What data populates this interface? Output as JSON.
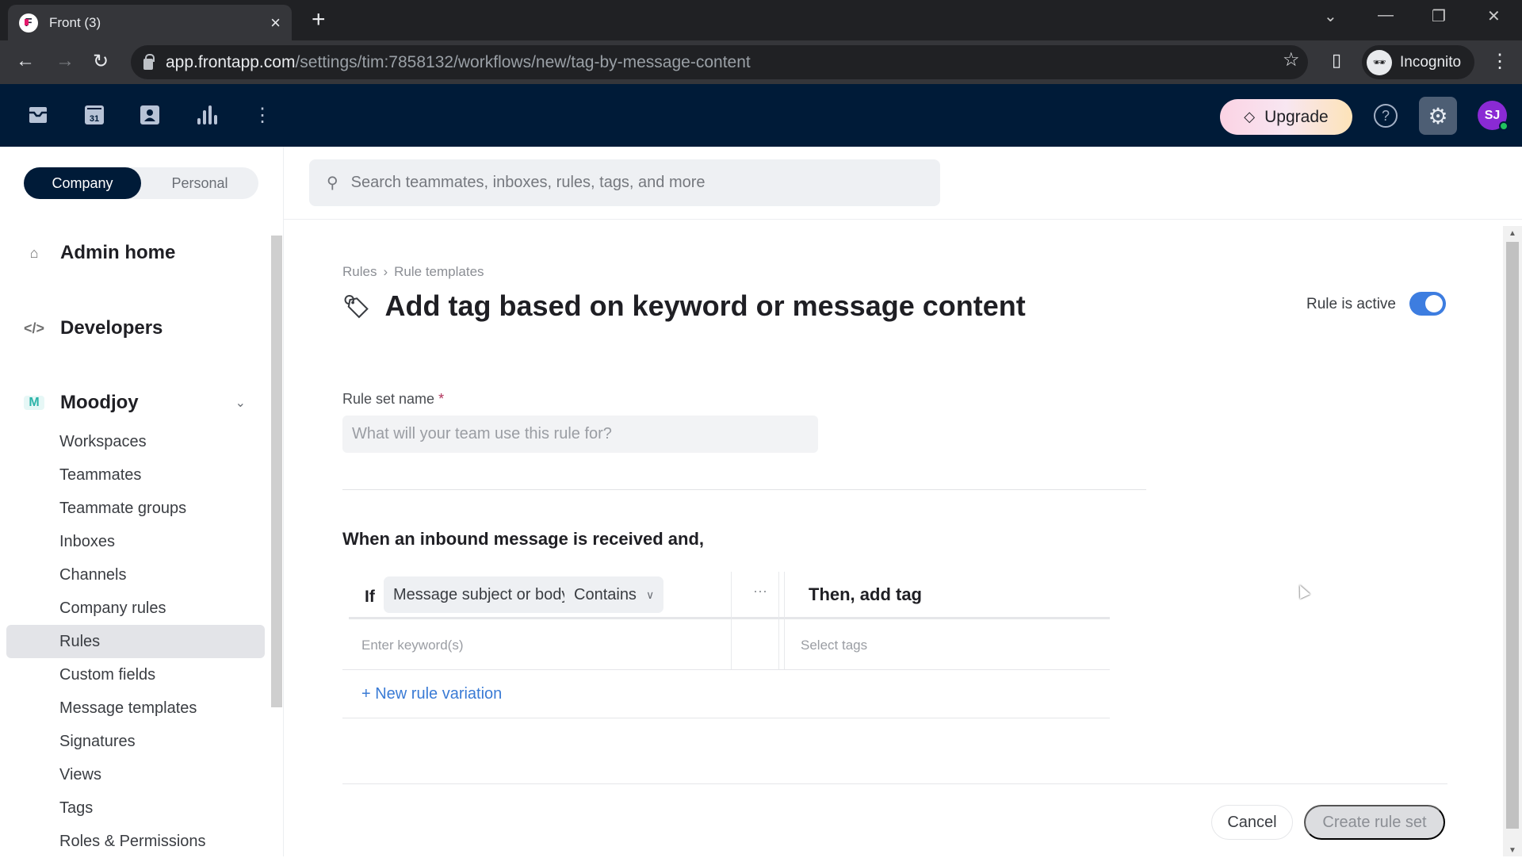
{
  "browser": {
    "tab_title": "Front (3)",
    "url_host": "app.frontapp.com",
    "url_path": "/settings/tim:7858132/workflows/new/tag-by-message-content",
    "profile_label": "Incognito"
  },
  "appbar": {
    "icons": [
      "inbox-icon",
      "calendar-icon",
      "contacts-icon",
      "analytics-icon",
      "more-icon"
    ],
    "calendar_day": "31",
    "upgrade_label": "Upgrade",
    "help_glyph": "?",
    "avatar_initials": "SJ",
    "colors": {
      "background": "#001b38",
      "avatar": "#8a2ad4",
      "presence": "#21c25e"
    }
  },
  "sidebar": {
    "segment": {
      "company": "Company",
      "personal": "Personal",
      "selected": "Company"
    },
    "top_items": [
      {
        "label": "Admin home",
        "icon": "home-icon"
      },
      {
        "label": "Developers",
        "icon": "code-icon"
      }
    ],
    "workspace": {
      "badge": "M",
      "label": "Moodjoy"
    },
    "items": [
      {
        "label": "Workspaces"
      },
      {
        "label": "Teammates"
      },
      {
        "label": "Teammate groups"
      },
      {
        "label": "Inboxes"
      },
      {
        "label": "Channels"
      },
      {
        "label": "Company rules"
      },
      {
        "label": "Rules",
        "active": true
      },
      {
        "label": "Custom fields"
      },
      {
        "label": "Message templates"
      },
      {
        "label": "Signatures"
      },
      {
        "label": "Views"
      },
      {
        "label": "Tags"
      },
      {
        "label": "Roles & Permissions"
      }
    ]
  },
  "search": {
    "placeholder": "Search teammates, inboxes, rules, tags, and more"
  },
  "page": {
    "breadcrumb": [
      "Rules",
      "Rule templates"
    ],
    "breadcrumb_sep": "›",
    "title": "Add tag based on keyword or message content",
    "active_label": "Rule is active",
    "active": true,
    "accent_color": "#3d7de0"
  },
  "form": {
    "name_label": "Rule set name",
    "required_mark": "*",
    "name_placeholder": "What will your team use this rule for?",
    "name_value": "",
    "condition_heading": "When an inbound message is received and,",
    "if_label": "If",
    "field_select": "Message subject or body",
    "operator_select": "Contains",
    "more_glyph": "···",
    "then_label": "Then, add tag",
    "keyword_placeholder": "Enter keyword(s)",
    "tags_placeholder": "Select tags",
    "new_variation": "+ New rule variation"
  },
  "actions": {
    "cancel": "Cancel",
    "create": "Create rule set"
  }
}
